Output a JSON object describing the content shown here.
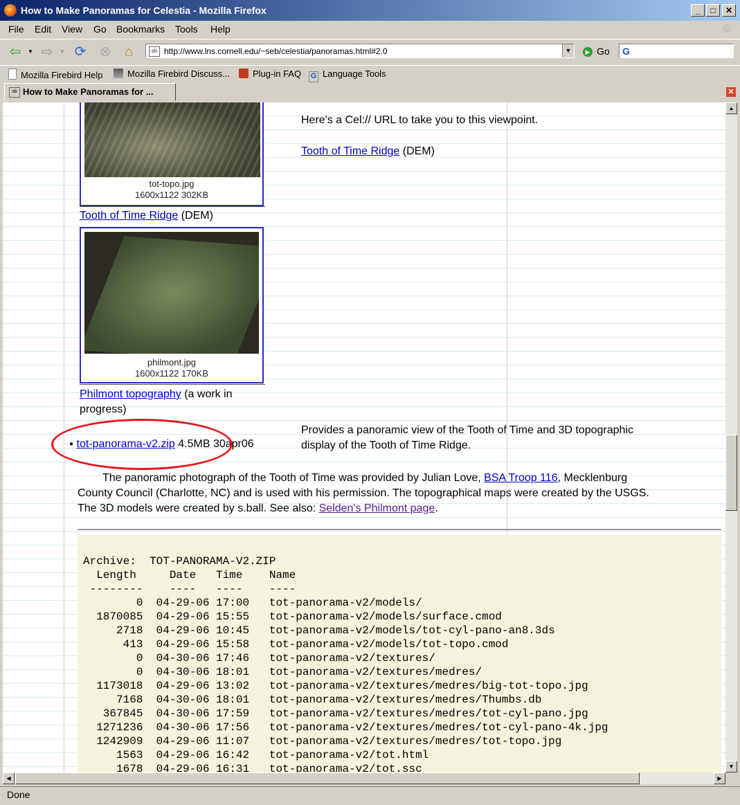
{
  "window": {
    "title": "How to Make Panoramas for Celestia - Mozilla Firefox"
  },
  "menu": [
    "File",
    "Edit",
    "View",
    "Go",
    "Bookmarks",
    "Tools",
    "Help"
  ],
  "toolbar": {
    "url": "http://www.lns.cornell.edu/~seb/celestia/panoramas.html#2.0",
    "go_label": "Go",
    "search_value": ""
  },
  "bookmarks": [
    "Mozilla Firebird Help",
    "Mozilla Firebird Discuss...",
    "Plug-in FAQ",
    "Language Tools"
  ],
  "tab": {
    "title": "How to Make Panoramas for ..."
  },
  "page": {
    "cel_text": "Here's a Cel:// URL to take you to this viewpoint.",
    "tooth_link": "Tooth of Time Ridge",
    "dem": "(DEM)",
    "topo_caption_name": "tot-topo.jpg",
    "topo_caption_size": "1600x1122 302KB",
    "phil_caption_name": "philmont.jpg",
    "phil_caption_size": "1600x1122 170KB",
    "phil_link": "Philmont topography",
    "phil_suffix_1": "(a work in",
    "phil_suffix_2": "progress)",
    "zip_link": "tot-panorama-v2.zip",
    "zip_size": "4.5MB",
    "zip_date": "30apr06",
    "provides_1": "Provides a panoramic view of the Tooth of Time and 3D topographic",
    "provides_2": "display of the Tooth of Time Ridge.",
    "para_1a": "The panoramic photograph of the Tooth of Time was provided by Julian Love,",
    "para_link1": "BSA Troop 116",
    "para_1b": ", Mecklenburg",
    "para_2": "County Council (Charlotte, NC) and is used with his permission. The topographical maps were created by the USGS.",
    "para_3a": "The 3D models were created by s.ball. See also:",
    "para_link2": "Selden's Philmont page",
    "para_3b": ".",
    "listing": "Archive:  TOT-PANORAMA-V2.ZIP\n  Length     Date   Time    Name\n --------    ----   ----    ----\n        0  04-29-06 17:00   tot-panorama-v2/models/\n  1870085  04-29-06 15:55   tot-panorama-v2/models/surface.cmod\n     2718  04-29-06 10:45   tot-panorama-v2/models/tot-cyl-pano-an8.3ds\n      413  04-29-06 15:58   tot-panorama-v2/models/tot-topo.cmod\n        0  04-30-06 17:46   tot-panorama-v2/textures/\n        0  04-30-06 18:01   tot-panorama-v2/textures/medres/\n  1173018  04-29-06 13:02   tot-panorama-v2/textures/medres/big-tot-topo.jpg\n     7168  04-30-06 18:01   tot-panorama-v2/textures/medres/Thumbs.db\n   367845  04-30-06 17:59   tot-panorama-v2/textures/medres/tot-cyl-pano.jpg\n  1271236  04-30-06 17:56   tot-panorama-v2/textures/medres/tot-cyl-pano-4k.jpg\n  1242909  04-29-06 11:07   tot-panorama-v2/textures/medres/tot-topo.jpg\n     1563  04-29-06 16:42   tot-panorama-v2/tot.html\n     1678  04-29-06 16:31   tot-panorama-v2/tot.ssc"
  },
  "status": {
    "text": "Done"
  },
  "colors": {
    "link": "#0000cc",
    "visited": "#551a8b",
    "highlight_circle": "#e8141c",
    "listing_bg": "#f4f3dc"
  }
}
